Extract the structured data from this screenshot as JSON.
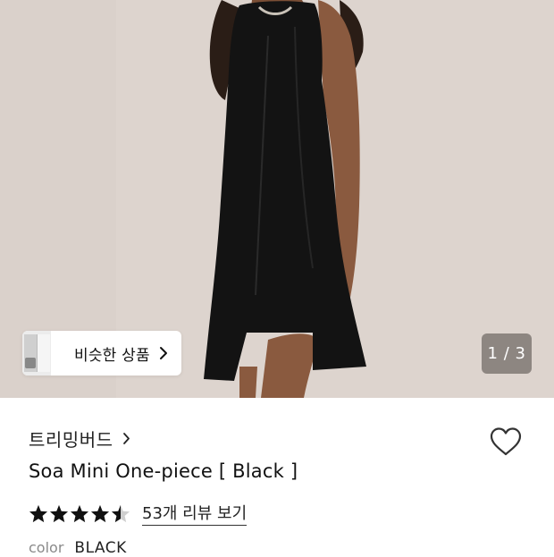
{
  "gallery": {
    "pager_text": "1 / 3",
    "similar_button_label": "비슷한 상품"
  },
  "product": {
    "brand": "트리밍버드",
    "title": "Soa Mini One-piece [ Black ]",
    "rating_stars": 4.5,
    "review_link": "53개 리뷰 보기",
    "option_label": "color",
    "option_value": "BLACK"
  },
  "icons": {
    "brand": "chevron-right-icon",
    "wish": "heart-outline-icon",
    "similar": "chevron-right-icon",
    "rating": "star-icon"
  },
  "colors": {
    "background_photo": "#dcd3cd",
    "dress": "#111111",
    "text": "#111111",
    "muted": "#8a8a8a",
    "pager_bg": "#6e6864"
  }
}
